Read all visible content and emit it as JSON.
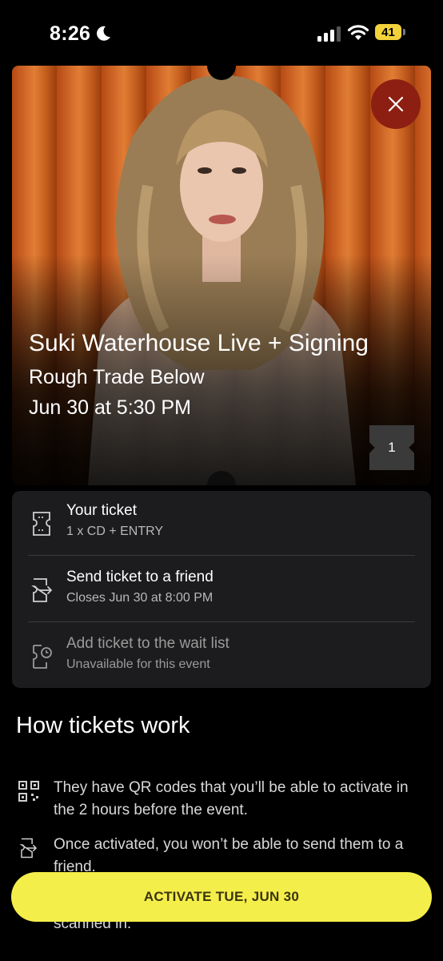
{
  "status_bar": {
    "time": "8:26",
    "battery": "41",
    "battery_color": "#f2d23a"
  },
  "event": {
    "title": "Suki Waterhouse Live + Signing",
    "venue": "Rough Trade Below",
    "datetime": "Jun 30 at 5:30 PM",
    "ticket_count": "1",
    "close_icon": "close-icon"
  },
  "options": [
    {
      "title": "Your ticket",
      "subtitle": "1 x CD + ENTRY",
      "icon": "ticket-icon",
      "enabled": true
    },
    {
      "title": "Send ticket to a friend",
      "subtitle": "Closes Jun 30 at 8:00 PM",
      "icon": "send-ticket-icon",
      "enabled": true
    },
    {
      "title": "Add ticket to the wait list",
      "subtitle": "Unavailable for this event",
      "icon": "waitlist-ticket-icon",
      "enabled": false
    }
  ],
  "how": {
    "heading": "How tickets work",
    "items": [
      {
        "icon": "qr-code-icon",
        "text": "They have QR codes that you’ll be able to activate in the 2 hours before the event."
      },
      {
        "icon": "send-ticket-icon",
        "text": "Once activated, you won’t be able to send them to a friend."
      },
      {
        "partial_text": "scanned in."
      }
    ]
  },
  "activate_button": {
    "label": "ACTIVATE TUE, JUN 30",
    "color": "#f4ee4a"
  },
  "colors": {
    "background": "#000000",
    "card": "#1c1c1e",
    "close_button": "#8c1f12"
  }
}
